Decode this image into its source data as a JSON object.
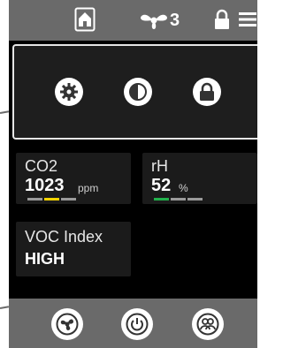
{
  "topbar": {
    "icons": [
      "home-icon",
      "fan-icon",
      "lock-icon",
      "menu-icon"
    ],
    "fan_speed": "3"
  },
  "panel": {
    "buttons": [
      "settings-icon",
      "contrast-icon",
      "lock-icon"
    ]
  },
  "sensors": {
    "co2": {
      "label": "CO2",
      "value": "1023",
      "unit": "ppm",
      "level": 2,
      "segments": 3
    },
    "rh": {
      "label": "rH",
      "value": "52",
      "unit": "%",
      "level": 1,
      "segments": 3
    },
    "voc": {
      "label": "VOC Index",
      "value": "HIGH"
    }
  },
  "bottombar": {
    "buttons": [
      "fan-icon",
      "power-icon",
      "users-icon"
    ]
  },
  "colors": {
    "bar_bg": "#6a6a6a",
    "card_bg": "#1b1b1b",
    "seg_gray": "#9a9a9a",
    "seg_yellow": "#f2d300",
    "seg_green": "#22b14c"
  }
}
